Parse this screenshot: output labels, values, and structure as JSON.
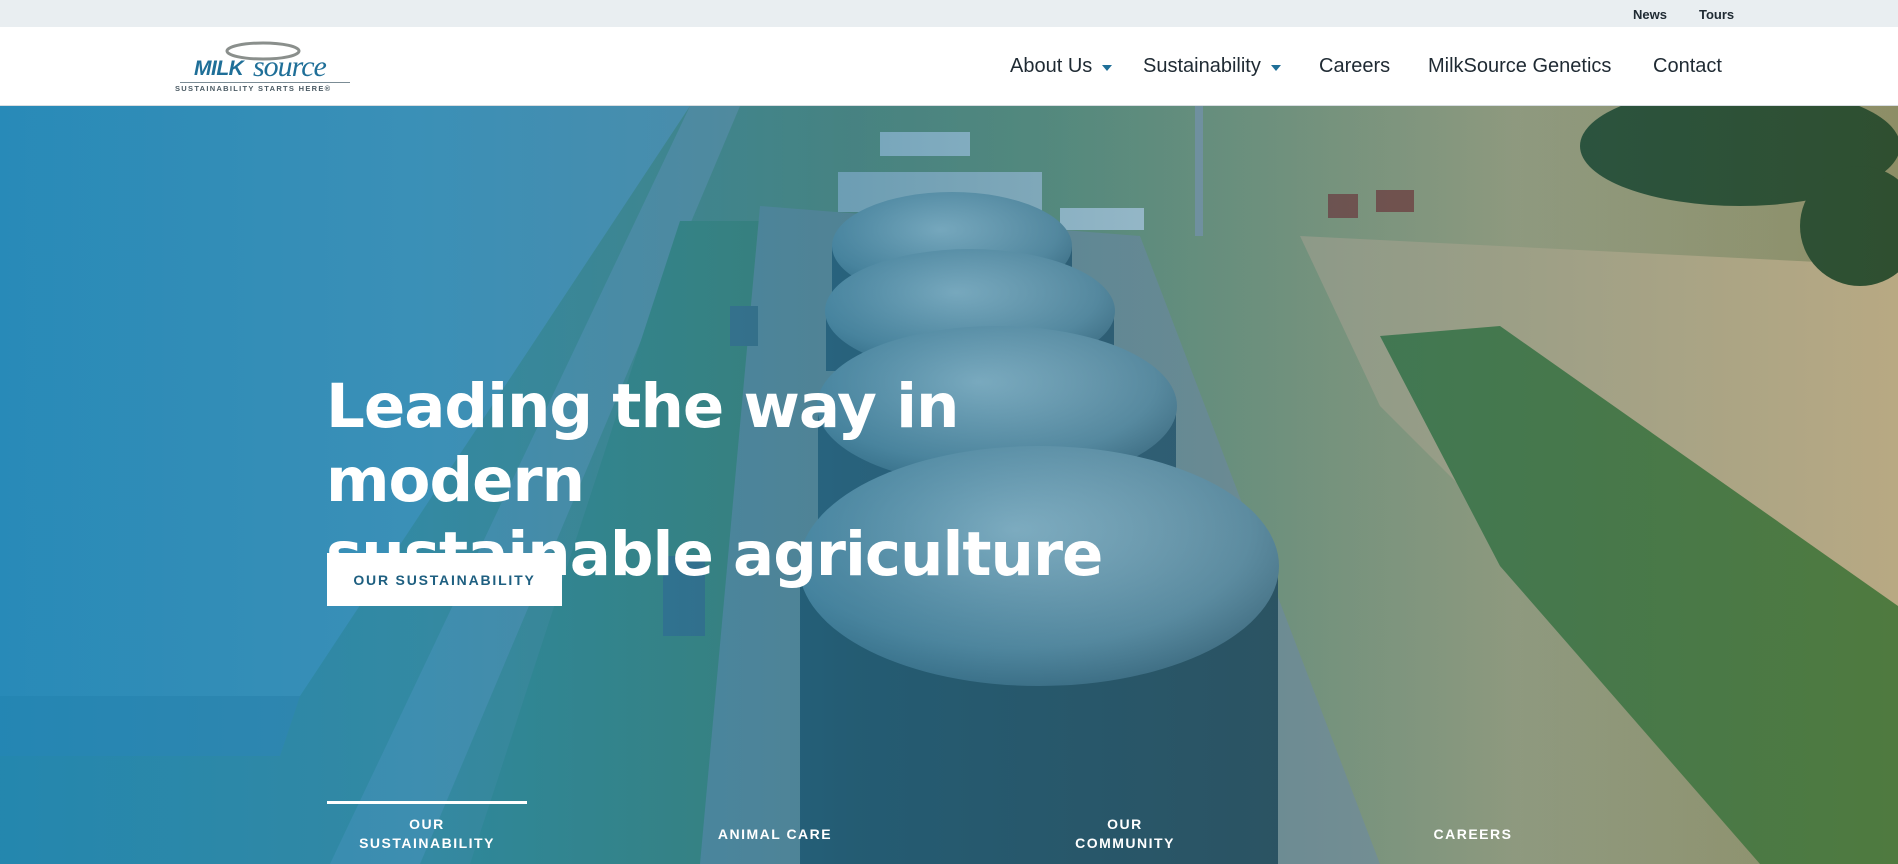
{
  "utility_nav": {
    "news": "News",
    "tours": "Tours"
  },
  "logo": {
    "brand_bold": "MILK",
    "brand_script": "source",
    "tagline": "SUSTAINABILITY STARTS HERE®"
  },
  "main_nav": {
    "about": "About Us",
    "sustainability": "Sustainability",
    "careers": "Careers",
    "genetics": "MilkSource Genetics",
    "contact": "Contact"
  },
  "hero": {
    "title_line1": "Leading the way in modern",
    "title_line2": "sustainable agriculture",
    "cta_label": "OUR SUSTAINABILITY",
    "tabs": [
      {
        "label": "OUR\nSUSTAINABILITY",
        "active": true
      },
      {
        "label": "ANIMAL CARE",
        "active": false
      },
      {
        "label": "OUR\nCOMMUNITY",
        "active": false
      },
      {
        "label": "CAREERS",
        "active": false
      }
    ]
  },
  "colors": {
    "accent": "#1f6f98",
    "overlay": "#1a86b8",
    "utility_bg": "#e9eef1"
  }
}
